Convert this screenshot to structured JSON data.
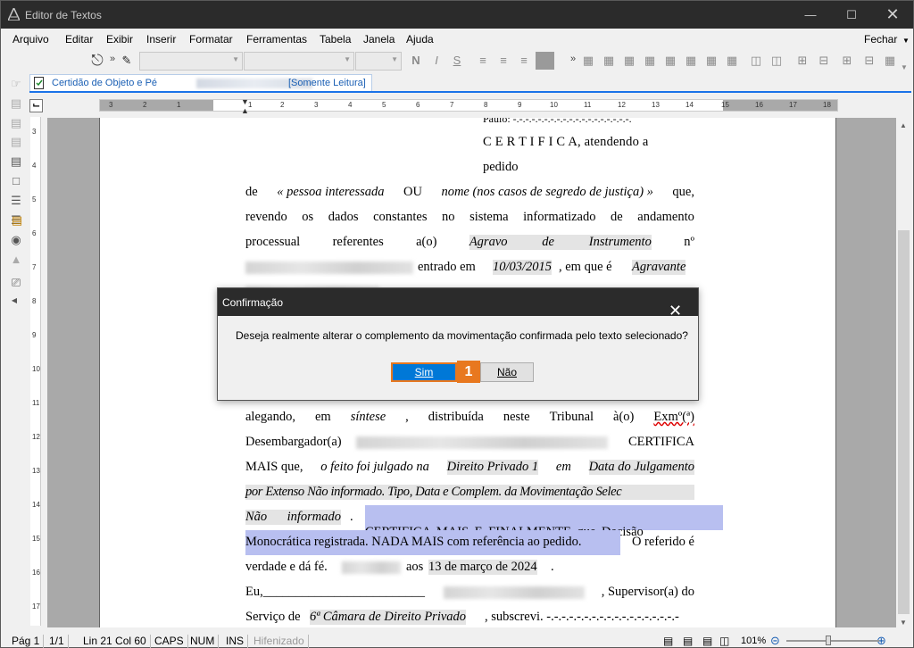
{
  "window": {
    "title": "Editor de Textos"
  },
  "menu": [
    "Arquivo",
    "Editar",
    "Exibir",
    "Inserir",
    "Formatar",
    "Ferramentas",
    "Tabela",
    "Janela",
    "Ajuda"
  ],
  "menu_right": "Fechar",
  "toolbar": {
    "bold": "N",
    "italic": "I",
    "strike": "S"
  },
  "tab": {
    "name": "Certidão de Objeto e Pé",
    "readonly": "[Somente Leitura]"
  },
  "ruler_numbers": [
    "3",
    "2",
    "1",
    "1",
    "2",
    "3",
    "4",
    "5",
    "6",
    "7",
    "8",
    "9",
    "10",
    "11",
    "12",
    "13",
    "14",
    "15",
    "16",
    "17",
    "18"
  ],
  "vruler_numbers": [
    "3",
    "4",
    "5",
    "6",
    "7",
    "8",
    "9",
    "10",
    "11",
    "12",
    "13",
    "14",
    "15",
    "16",
    "17"
  ],
  "document": {
    "l0": "Paulo: -.-.-.-.-.-.-.-.-.-.-.-.-.-.-.-.-.-.-.",
    "l1": "C E R T I F I C A, atendendo a",
    "l2": "pedido",
    "l3": [
      "de",
      "« pessoa interessada",
      "OU",
      "nome (nos casos de segredo de justiça) »",
      "que,"
    ],
    "l4": [
      "revendo",
      "os",
      "dados",
      "constantes",
      "no",
      "sistema",
      "informatizado",
      "de",
      "andamento"
    ],
    "l5": [
      "processual",
      "referentes",
      "a(o)",
      "Agravo de Instrumento",
      "nº"
    ],
    "l6": [
      "entrado em",
      "10/03/2015",
      ", em que é",
      "Agravante"
    ],
    "l7": [
      "alegando,",
      "em",
      "síntese",
      ",",
      "distribuída",
      "neste",
      "Tribunal",
      "à(o)",
      "Exmº(ª)"
    ],
    "l8": [
      "Desembargador(a)",
      "CERTIFICA"
    ],
    "l9": [
      "MAIS que,",
      "o feito foi julgado na",
      "Direito Privado 1",
      "em",
      "Data do Julgamento"
    ],
    "l10": "por Extenso Não informado. Tipo, Data e Complem. da Movimentação Selec",
    "l11": [
      "Não informado",
      ".",
      "CERTIFICA MAIS E FINALMENTE que Decisão"
    ],
    "l12": [
      "Monocrática registrada. NADA MAIS com referência ao pedido.",
      "O referido é"
    ],
    "l13": [
      "verdade e dá fé.",
      "aos",
      "13 de março de 2024",
      "."
    ],
    "l14": [
      "Eu,_________________________",
      ", Supervisor(a) do"
    ],
    "l15": [
      "Serviço de",
      "6ª Câmara de Direito Privado",
      ", subscrevi. -.-.-.-.-.-.-.-.-.-.-.-.-.-.-.-.-.-"
    ]
  },
  "dialog": {
    "title": "Confirmação",
    "message": "Deseja realmente alterar o complemento da movimentação confirmada pelo texto selecionado?",
    "yes": "Sim",
    "no": "Não",
    "badge": "1"
  },
  "status": {
    "page": "Pág 1",
    "pages": "1/1",
    "pos": "Lin 21  Col 60",
    "caps": "CAPS",
    "num": "NUM",
    "ins": "INS",
    "hyph": "Hifenizado",
    "zoom": "101%"
  },
  "colors": {
    "accent": "#0078d7",
    "badge": "#e8781f",
    "selection": "#b8bff0",
    "titlebar": "#2b2b2b"
  }
}
